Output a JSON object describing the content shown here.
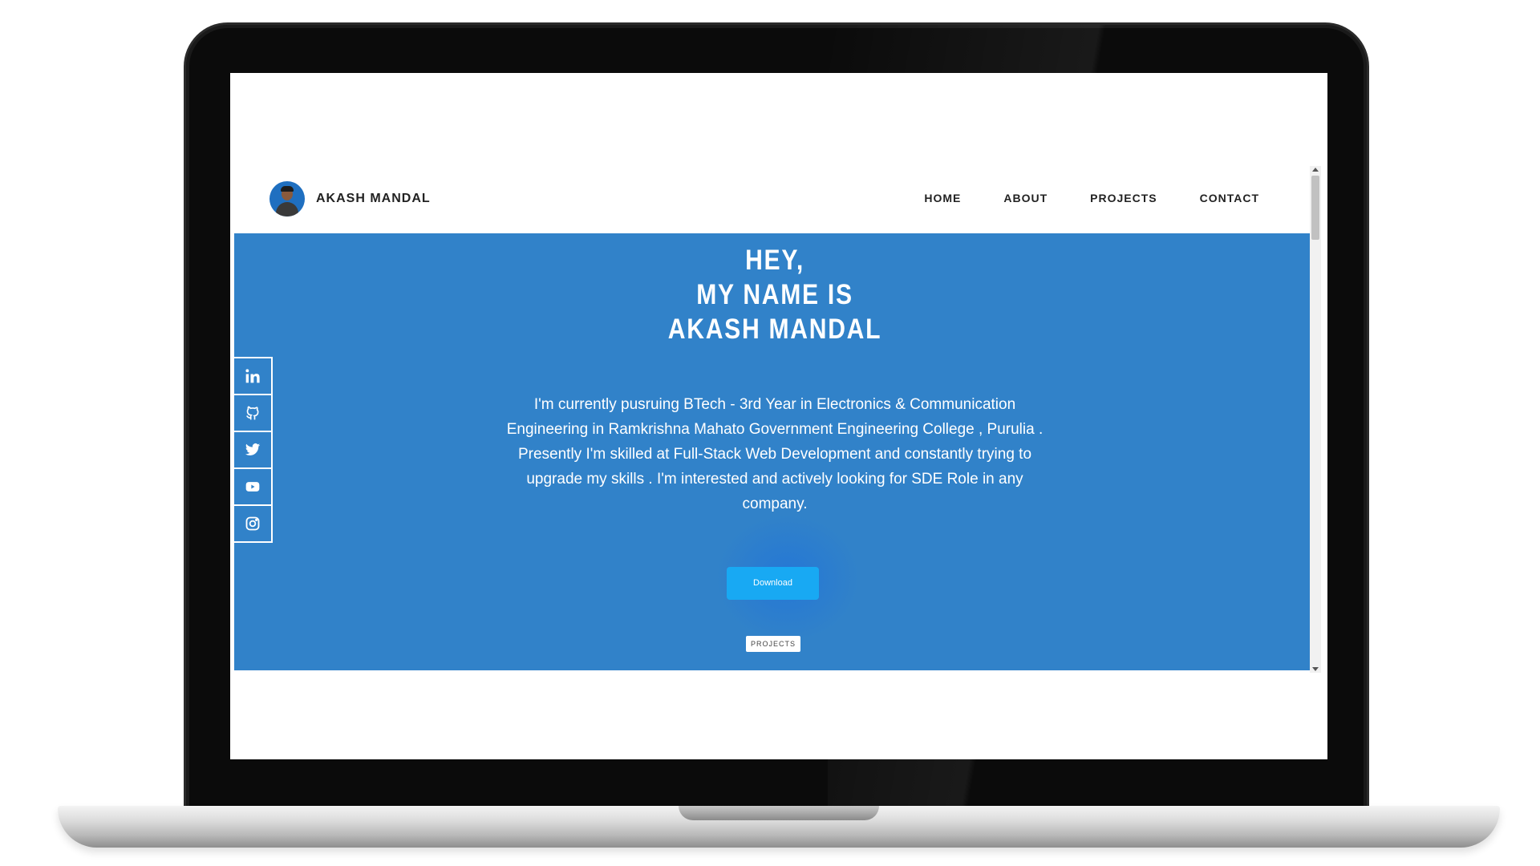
{
  "navbar": {
    "brand_name": "AKASH MANDAL",
    "links": [
      "HOME",
      "ABOUT",
      "PROJECTS",
      "CONTACT"
    ]
  },
  "hero": {
    "headline_line1": "HEY,",
    "headline_line2": "MY NAME IS",
    "headline_line3": "AKASH MANDAL",
    "intro": "I'm currently pusruing BTech - 3rd Year in Electronics & Communication Engineering in Ramkrishna Mahato Government Engineering College , Purulia . Presently I'm skilled at Full-Stack Web Development and constantly trying to upgrade my skills . I'm interested and actively looking for SDE Role in any company.",
    "download_label": "Download",
    "projects_label": "PROJECTS"
  },
  "social": [
    "linkedin-icon",
    "github-icon",
    "twitter-icon",
    "youtube-icon",
    "instagram-icon"
  ],
  "colors": {
    "hero_bg": "#3182c9",
    "button_bg": "#18a9f3",
    "text_dark": "#222222"
  }
}
